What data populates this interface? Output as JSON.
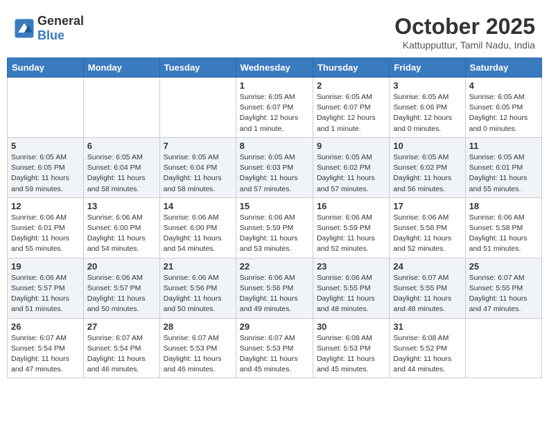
{
  "header": {
    "logo_line1": "General",
    "logo_line2": "Blue",
    "month": "October 2025",
    "location": "Kattupputtur, Tamil Nadu, India"
  },
  "weekdays": [
    "Sunday",
    "Monday",
    "Tuesday",
    "Wednesday",
    "Thursday",
    "Friday",
    "Saturday"
  ],
  "weeks": [
    [
      {
        "day": "",
        "info": ""
      },
      {
        "day": "",
        "info": ""
      },
      {
        "day": "",
        "info": ""
      },
      {
        "day": "1",
        "info": "Sunrise: 6:05 AM\nSunset: 6:07 PM\nDaylight: 12 hours\nand 1 minute."
      },
      {
        "day": "2",
        "info": "Sunrise: 6:05 AM\nSunset: 6:07 PM\nDaylight: 12 hours\nand 1 minute."
      },
      {
        "day": "3",
        "info": "Sunrise: 6:05 AM\nSunset: 6:06 PM\nDaylight: 12 hours\nand 0 minutes."
      },
      {
        "day": "4",
        "info": "Sunrise: 6:05 AM\nSunset: 6:05 PM\nDaylight: 12 hours\nand 0 minutes."
      }
    ],
    [
      {
        "day": "5",
        "info": "Sunrise: 6:05 AM\nSunset: 6:05 PM\nDaylight: 11 hours\nand 59 minutes."
      },
      {
        "day": "6",
        "info": "Sunrise: 6:05 AM\nSunset: 6:04 PM\nDaylight: 11 hours\nand 58 minutes."
      },
      {
        "day": "7",
        "info": "Sunrise: 6:05 AM\nSunset: 6:04 PM\nDaylight: 11 hours\nand 58 minutes."
      },
      {
        "day": "8",
        "info": "Sunrise: 6:05 AM\nSunset: 6:03 PM\nDaylight: 11 hours\nand 57 minutes."
      },
      {
        "day": "9",
        "info": "Sunrise: 6:05 AM\nSunset: 6:02 PM\nDaylight: 11 hours\nand 57 minutes."
      },
      {
        "day": "10",
        "info": "Sunrise: 6:05 AM\nSunset: 6:02 PM\nDaylight: 11 hours\nand 56 minutes."
      },
      {
        "day": "11",
        "info": "Sunrise: 6:05 AM\nSunset: 6:01 PM\nDaylight: 11 hours\nand 55 minutes."
      }
    ],
    [
      {
        "day": "12",
        "info": "Sunrise: 6:06 AM\nSunset: 6:01 PM\nDaylight: 11 hours\nand 55 minutes."
      },
      {
        "day": "13",
        "info": "Sunrise: 6:06 AM\nSunset: 6:00 PM\nDaylight: 11 hours\nand 54 minutes."
      },
      {
        "day": "14",
        "info": "Sunrise: 6:06 AM\nSunset: 6:00 PM\nDaylight: 11 hours\nand 54 minutes."
      },
      {
        "day": "15",
        "info": "Sunrise: 6:06 AM\nSunset: 5:59 PM\nDaylight: 11 hours\nand 53 minutes."
      },
      {
        "day": "16",
        "info": "Sunrise: 6:06 AM\nSunset: 5:59 PM\nDaylight: 11 hours\nand 52 minutes."
      },
      {
        "day": "17",
        "info": "Sunrise: 6:06 AM\nSunset: 5:58 PM\nDaylight: 11 hours\nand 52 minutes."
      },
      {
        "day": "18",
        "info": "Sunrise: 6:06 AM\nSunset: 5:58 PM\nDaylight: 11 hours\nand 51 minutes."
      }
    ],
    [
      {
        "day": "19",
        "info": "Sunrise: 6:06 AM\nSunset: 5:57 PM\nDaylight: 11 hours\nand 51 minutes."
      },
      {
        "day": "20",
        "info": "Sunrise: 6:06 AM\nSunset: 5:57 PM\nDaylight: 11 hours\nand 50 minutes."
      },
      {
        "day": "21",
        "info": "Sunrise: 6:06 AM\nSunset: 5:56 PM\nDaylight: 11 hours\nand 50 minutes."
      },
      {
        "day": "22",
        "info": "Sunrise: 6:06 AM\nSunset: 5:56 PM\nDaylight: 11 hours\nand 49 minutes."
      },
      {
        "day": "23",
        "info": "Sunrise: 6:06 AM\nSunset: 5:55 PM\nDaylight: 11 hours\nand 48 minutes."
      },
      {
        "day": "24",
        "info": "Sunrise: 6:07 AM\nSunset: 5:55 PM\nDaylight: 11 hours\nand 48 minutes."
      },
      {
        "day": "25",
        "info": "Sunrise: 6:07 AM\nSunset: 5:55 PM\nDaylight: 11 hours\nand 47 minutes."
      }
    ],
    [
      {
        "day": "26",
        "info": "Sunrise: 6:07 AM\nSunset: 5:54 PM\nDaylight: 11 hours\nand 47 minutes."
      },
      {
        "day": "27",
        "info": "Sunrise: 6:07 AM\nSunset: 5:54 PM\nDaylight: 11 hours\nand 46 minutes."
      },
      {
        "day": "28",
        "info": "Sunrise: 6:07 AM\nSunset: 5:53 PM\nDaylight: 11 hours\nand 46 minutes."
      },
      {
        "day": "29",
        "info": "Sunrise: 6:07 AM\nSunset: 5:53 PM\nDaylight: 11 hours\nand 45 minutes."
      },
      {
        "day": "30",
        "info": "Sunrise: 6:08 AM\nSunset: 5:53 PM\nDaylight: 11 hours\nand 45 minutes."
      },
      {
        "day": "31",
        "info": "Sunrise: 6:08 AM\nSunset: 5:52 PM\nDaylight: 11 hours\nand 44 minutes."
      },
      {
        "day": "",
        "info": ""
      }
    ]
  ]
}
